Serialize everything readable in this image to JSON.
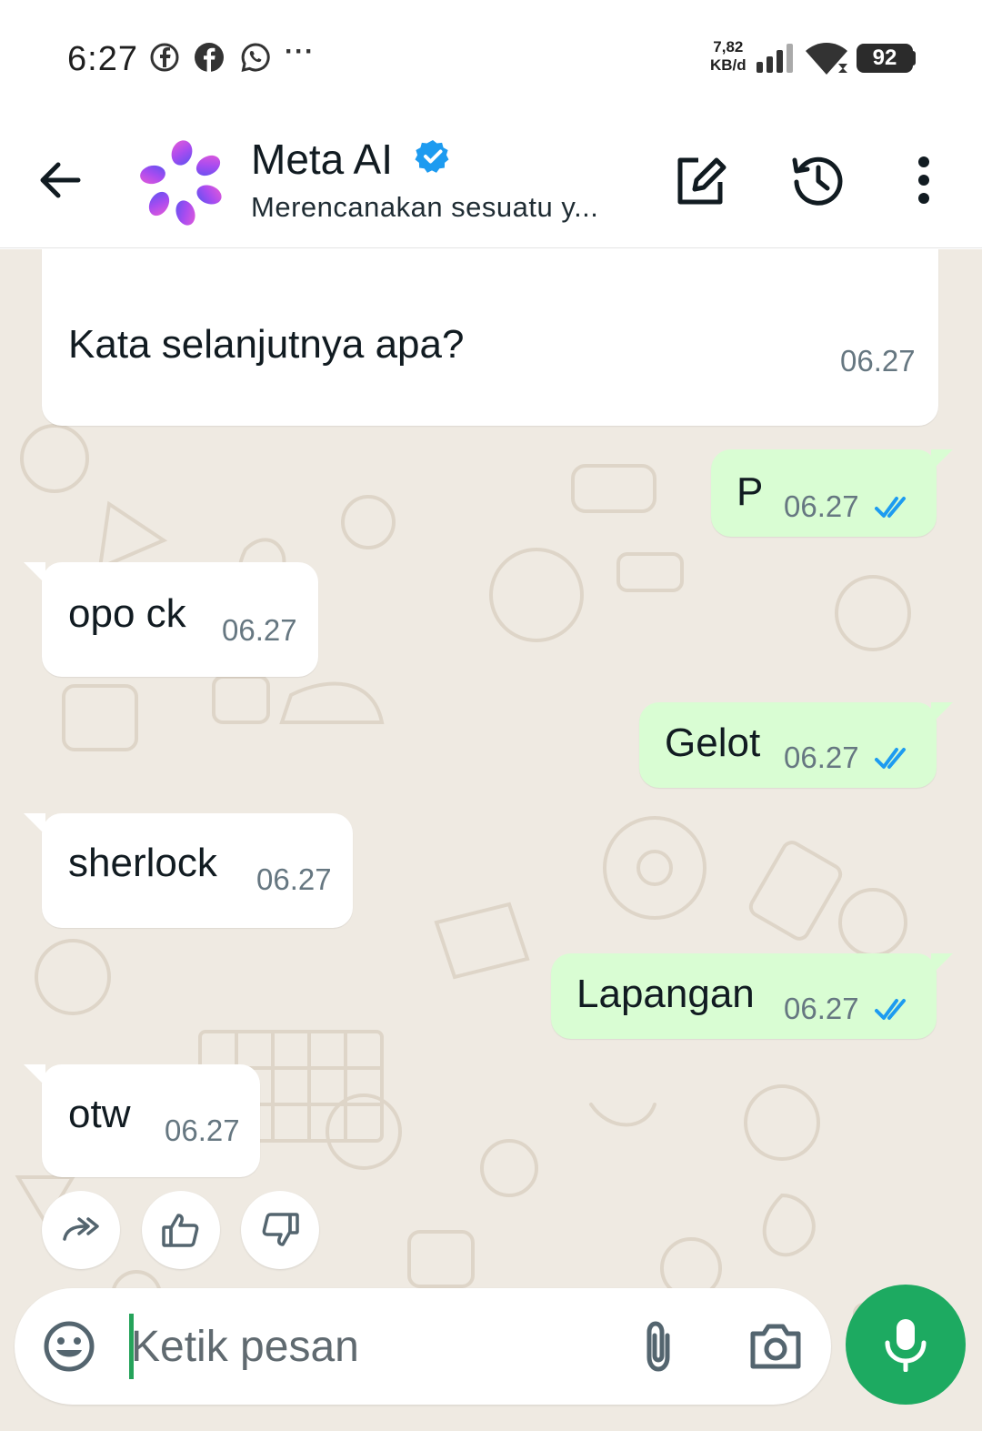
{
  "status_bar": {
    "time": "6:27",
    "net_speed_value": "7,82",
    "net_speed_unit": "KB/d",
    "battery": "92",
    "icons": [
      "facebook-outline-icon",
      "facebook-icon",
      "whatsapp-icon",
      "more-dots-icon",
      "signal-icon",
      "wifi-icon",
      "battery-icon"
    ]
  },
  "header": {
    "title": "Meta AI",
    "subtitle": "Merencanakan sesuatu y...",
    "icons": [
      "back-arrow-icon",
      "meta-ai-logo-icon",
      "verified-badge-icon",
      "new-chat-edit-icon",
      "history-icon",
      "more-vert-icon"
    ]
  },
  "messages": [
    {
      "direction": "in",
      "text": "Kata selanjutnya apa?",
      "time": "06.27"
    },
    {
      "direction": "out",
      "text": "P",
      "time": "06.27",
      "status": "read"
    },
    {
      "direction": "in",
      "text": "opo ck",
      "time": "06.27"
    },
    {
      "direction": "out",
      "text": "Gelot",
      "time": "06.27",
      "status": "read"
    },
    {
      "direction": "in",
      "text": "sherlock",
      "time": "06.27"
    },
    {
      "direction": "out",
      "text": "Lapangan",
      "time": "06.27",
      "status": "read"
    },
    {
      "direction": "in",
      "text": "otw",
      "time": "06.27"
    }
  ],
  "reactions": {
    "icons": [
      "forward-icon",
      "thumbs-up-icon",
      "thumbs-down-icon"
    ]
  },
  "composer": {
    "placeholder": "Ketik pesan",
    "icons": [
      "emoji-icon",
      "attach-icon",
      "camera-icon",
      "mic-icon"
    ]
  },
  "colors": {
    "chat_background": "#efeae2",
    "incoming_bubble": "#ffffff",
    "outgoing_bubble": "#d9fdd3",
    "read_ticks": "#1d9bf0",
    "mic_button": "#1daa61",
    "cursor": "#25a35a"
  }
}
